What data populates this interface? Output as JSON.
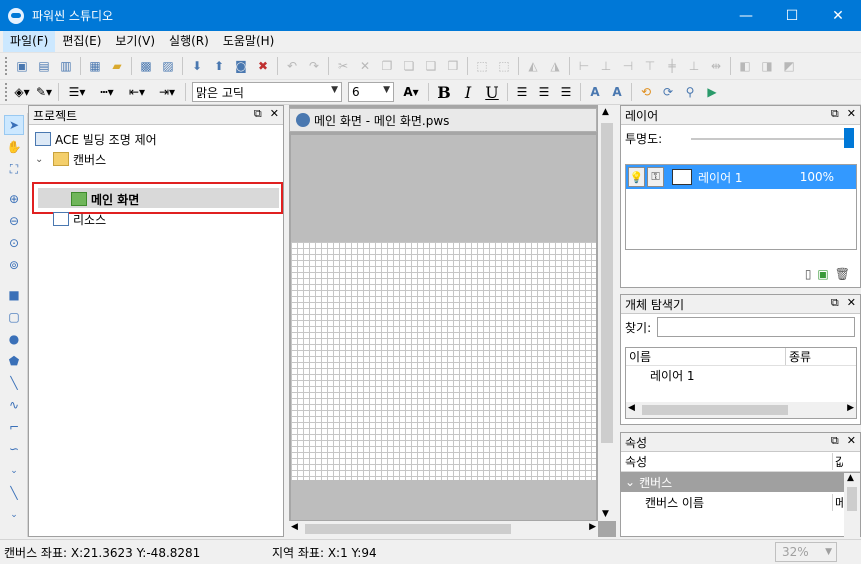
{
  "window": {
    "title": "파워씬 스튜디오",
    "min": "—",
    "max": "☐",
    "close": "✕"
  },
  "menu": [
    "파일(F)",
    "편집(E)",
    "보기(V)",
    "실행(R)",
    "도움말(H)"
  ],
  "format_bar": {
    "font_name": "맑은 고딕",
    "font_size": "6",
    "bold": "B",
    "italic": "I",
    "underline": "U"
  },
  "project_panel": {
    "title": "프로젝트",
    "root": "ACE 빌딩 조명 제어",
    "canvas_folder": "캔버스",
    "screen": "메인 화면",
    "resources": "리소스"
  },
  "document": {
    "tab_title": "메인 화면 - 메인 화면.pws"
  },
  "layers_panel": {
    "title": "레이어",
    "opacity_label": "투명도:",
    "opacity": 1.0,
    "layer_name": "레이어 1",
    "layer_opacity": "100%"
  },
  "explorer_panel": {
    "title": "개체 탐색기",
    "find_label": "찾기:",
    "col_name": "이름",
    "col_type": "종류",
    "row_name": "레이어 1"
  },
  "properties_panel": {
    "title": "속성",
    "col_prop": "속성",
    "col_val_clip": "값",
    "category": "캔버스",
    "row_name": "캔버스 이름",
    "row_val_clip": "메"
  },
  "status": {
    "canvas_coords": "캔버스 좌표: X:21.3623 Y:-48.8281",
    "local_coords": "지역 좌표: X:1 Y:94",
    "zoom": "32%"
  },
  "colors": {
    "titlebar": "#0078d7",
    "selection": "#3399ff",
    "highlight_box": "#e02020"
  }
}
